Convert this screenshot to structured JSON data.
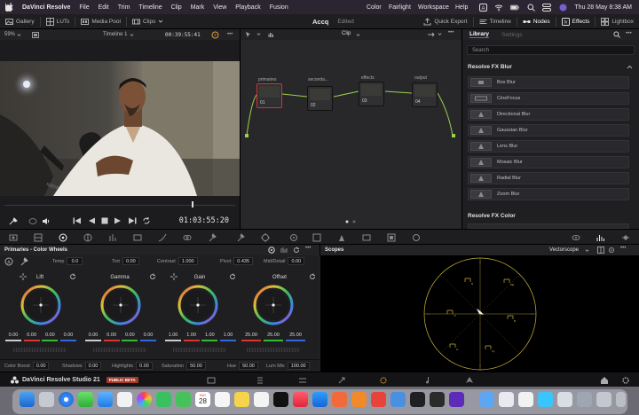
{
  "menubar": {
    "app": "DaVinci Resolve",
    "items": [
      "File",
      "Edit",
      "Trim",
      "Timeline",
      "Clip",
      "Mark",
      "View",
      "Playback",
      "Fusion",
      "Color",
      "Fairlight",
      "Workspace",
      "Help"
    ],
    "datetime": "Thu 28 May 8:38 AM"
  },
  "toolbar": {
    "gallery": "Gallery",
    "luts": "LUTs",
    "media_pool": "Media Pool",
    "clips": "Clips",
    "project": "Accq",
    "state": "Edited",
    "quick_export": "Quick Export",
    "timeline": "Timeline",
    "nodes": "Nodes",
    "effects": "Effects",
    "lightbox": "Lightbox"
  },
  "viewer": {
    "zoom": "59%",
    "timeline_name": "Timeline 1",
    "timecode": "00:39:55:41",
    "current_timecode": "01:03:55:20"
  },
  "nodes": {
    "mode": "Clip",
    "items": [
      {
        "label": "primaries",
        "num": "01"
      },
      {
        "label": "seconda...",
        "num": "02"
      },
      {
        "label": "effects",
        "num": "03"
      },
      {
        "label": "output",
        "num": "04"
      }
    ]
  },
  "library": {
    "tab_library": "Library",
    "tab_settings": "Settings",
    "search_placeholder": "Search",
    "section_blur": "Resolve FX Blur",
    "section_color": "Resolve FX Color",
    "blur_items": [
      "Box Blur",
      "CineFocus",
      "Directional Blur",
      "Gaussian Blur",
      "Lens Blur",
      "Mosaic Blur",
      "Radial Blur",
      "Zoom Blur"
    ]
  },
  "wheels": {
    "title": "Primaries - Color Wheels",
    "temp_label": "Temp",
    "temp": "0.0",
    "tint_label": "Tint",
    "tint": "0.00",
    "contrast_label": "Contrast",
    "contrast": "1.000",
    "pivot_label": "Pivot",
    "pivot": "0.435",
    "middetail_label": "Mid/Detail",
    "middetail": "0.00",
    "lift": {
      "title": "Lift",
      "values": [
        "0.00",
        "0.00",
        "0.00",
        "0.00"
      ]
    },
    "gamma": {
      "title": "Gamma",
      "values": [
        "0.00",
        "0.00",
        "0.00",
        "0.00"
      ]
    },
    "gain": {
      "title": "Gain",
      "values": [
        "1.00",
        "1.00",
        "1.00",
        "1.00"
      ]
    },
    "offset": {
      "title": "Offset",
      "values": [
        "25.00",
        "25.00",
        "25.00"
      ]
    },
    "colorboost_label": "Color Boost",
    "colorboost": "0.00",
    "shadows_label": "Shadows",
    "shadows": "0.00",
    "highlights_label": "Highlights",
    "highlights": "0.00",
    "saturation_label": "Saturation",
    "saturation": "50.00",
    "hue_label": "Hue",
    "hue": "50.00",
    "lummix_label": "Lum Mix",
    "lummix": "100.00"
  },
  "scopes": {
    "title": "Scopes",
    "mode": "Vectorscope"
  },
  "pages_bar": {
    "brand": "DaVinci Resolve Studio 21",
    "beta": "PUBLIC BETA"
  },
  "dock": {
    "calendar_month": "MAY",
    "calendar_day": "28"
  },
  "colors": {
    "accent": "#2a7bd6",
    "node_link": "#9ad34a",
    "vectorscope": "#c9b33a",
    "beta_badge": "#a23a2a"
  }
}
